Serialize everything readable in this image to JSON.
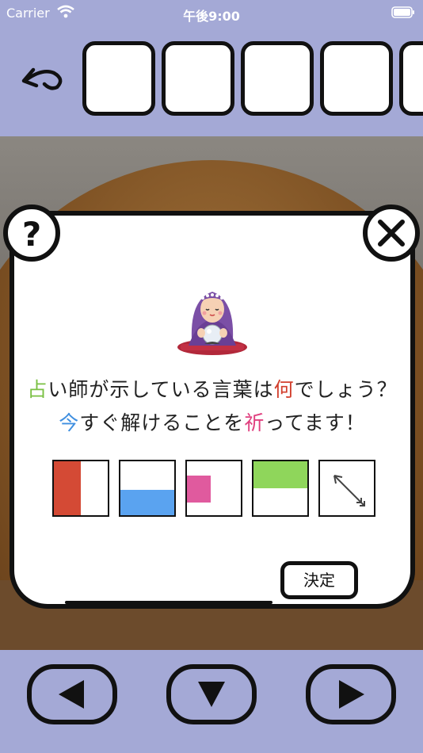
{
  "status_bar": {
    "carrier": "Carrier",
    "time": "午後9:00"
  },
  "top_bar": {
    "back_icon": "return-arrow-icon",
    "item_slots": [
      "",
      "",
      "",
      "",
      ""
    ]
  },
  "dialog": {
    "help_label": "?",
    "question_line1": {
      "pre": "",
      "hl1": "占",
      "mid": "い師が示している言葉は",
      "hl2": "何",
      "post": "でしょう？"
    },
    "question_line2": {
      "pre": "",
      "hl1": "今",
      "mid": "すぐ解けることを",
      "hl2": "祈",
      "post": "ってます！"
    },
    "highlight_colors": {
      "green": "#7ac043",
      "red": "#d23f2d",
      "blue": "#3f8fe0",
      "pink": "#e0407f"
    },
    "cards": [
      {
        "icon": "red-left-half-card",
        "color": "#d44a35"
      },
      {
        "icon": "blue-bottom-half-card",
        "color": "#5aa3f0"
      },
      {
        "icon": "pink-small-square-card",
        "color": "#e05a9e"
      },
      {
        "icon": "green-top-half-card",
        "color": "#8fd65b"
      },
      {
        "icon": "arrow-card",
        "color": "#555555"
      }
    ],
    "decide_label": "決定"
  },
  "bottom_nav": {
    "left_icon": "left-triangle-icon",
    "down_icon": "down-triangle-icon",
    "right_icon": "right-triangle-icon"
  },
  "colors": {
    "panel_bg": "#a4a9d6",
    "outline": "#111111"
  }
}
